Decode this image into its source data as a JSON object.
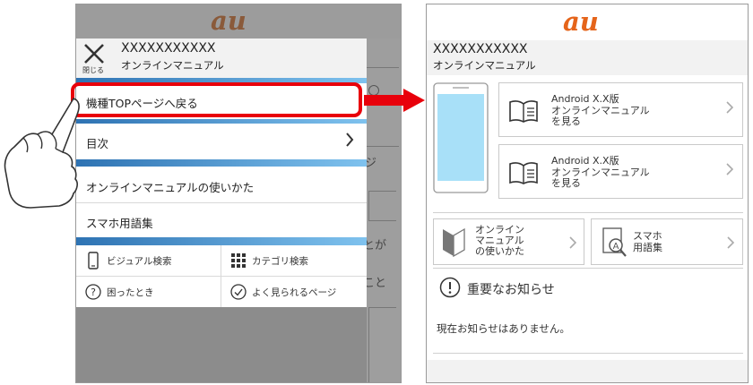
{
  "left": {
    "logo": "au",
    "close_label": "閉じる",
    "site_title": "XXXXXXXXXXX",
    "site_subtitle": "オンラインマニュアル",
    "menu": {
      "back_top": "機種TOPページへ戻る",
      "toc": "目次",
      "how_to_use": "オンラインマニュアルの使いかた",
      "glossary": "スマホ用語集"
    },
    "grid": {
      "visual_search": "ビジュアル検索",
      "category_search": "カテゴリ検索",
      "troubleshoot": "困ったとき",
      "faq": "よく見られるページ"
    },
    "background_fragments": [
      "ジ",
      "とが",
      "こと"
    ]
  },
  "right": {
    "logo": "au",
    "site_title": "XXXXXXXXXXX",
    "site_subtitle": "オンラインマニュアル",
    "cards": [
      {
        "text": "Android X.X版\nオンラインマニュアル\nを見る"
      },
      {
        "text": "Android X.X版\nオンラインマニュアル\nを見る"
      }
    ],
    "small_cards": [
      {
        "text": "オンライン\nマニュアル\nの使いかた"
      },
      {
        "text": "スマホ\n用語集"
      }
    ],
    "notice_title": "重要なお知らせ",
    "notice_body": "現在お知らせはありません。"
  },
  "colors": {
    "accent_red": "#e8000b",
    "au_orange": "#e5641a",
    "blue_bar_start": "#2e73b3",
    "blue_bar_end": "#7fc2ee",
    "screen_blue": "#a8e0f8"
  },
  "icons": [
    "close-icon",
    "chevron-right-icon",
    "smartphone-icon",
    "grid-icon",
    "question-icon",
    "check-circle-icon",
    "book-icon",
    "beginner-mark-icon",
    "magnifier-a-icon",
    "exclamation-icon",
    "arrow-right-icon",
    "hand-pointer-icon"
  ]
}
